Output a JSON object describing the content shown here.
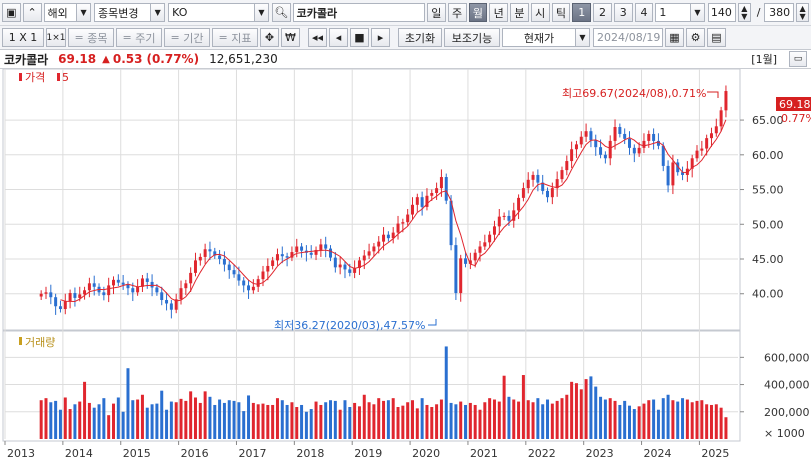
{
  "toolbar": {
    "market": "해외",
    "change_label": "종목변경",
    "symbol": "KO",
    "name": "코카콜라",
    "periods": [
      "일",
      "주",
      "월",
      "년",
      "분",
      "시",
      "틱"
    ],
    "active_period": "월",
    "counts": [
      "1",
      "2",
      "3",
      "4"
    ],
    "active_count": "1",
    "count_value": "1",
    "visible_bars": "140",
    "separator": "/",
    "total_bars": "380"
  },
  "toolbar2": {
    "layout_label": "1 X 1",
    "grid_label": "1×1",
    "stock_label": "종목",
    "cycle_label": "주기",
    "range_label": "기간",
    "indicator_label": "지표",
    "won_label": "₩",
    "reset_label": "초기화",
    "aux_label": "보조기능",
    "current_label": "현재가",
    "date_value": "2024/08/19"
  },
  "info": {
    "name": "코카콜라",
    "price": "69.18",
    "change_arrow": "▲",
    "change": "0.53",
    "change_pct": "(0.77%)",
    "volume": "12,651,230",
    "period_badge": "[1월]"
  },
  "chart_data": {
    "type": "candlestick",
    "legend_price": "가격",
    "legend_ma": "5",
    "legend_volume": "거래량",
    "price_axis": [
      "65.00",
      "60.00",
      "55.00",
      "50.00",
      "45.00",
      "40.00"
    ],
    "price_range": [
      35.5,
      71.2
    ],
    "volume_axis": [
      "600,000",
      "400,000",
      "200,000",
      "× 1000"
    ],
    "volume_range": [
      0,
      720000
    ],
    "current_price_label": "69.18",
    "current_pct_label": "0.77%",
    "max_annotation": "최고69.67(2024/08),0.71%",
    "min_annotation": "최저36.27(2020/03),47.57%",
    "years": [
      "2013",
      "2014",
      "2015",
      "2016",
      "2017",
      "2018",
      "2019",
      "2020",
      "2021",
      "2022",
      "2023",
      "2024",
      "2025"
    ],
    "first_month": "2013-01",
    "last_month": "2025-08",
    "colors": {
      "up": "#e0262e",
      "down": "#2a6fd0",
      "ma": "#e0262e",
      "grid": "#dddddd"
    },
    "closes": [
      40.0,
      40.2,
      39.5,
      38.2,
      37.8,
      38.9,
      40.1,
      39.4,
      39.9,
      40.5,
      41.5,
      41.0,
      40.2,
      39.8,
      41.2,
      42.0,
      41.6,
      41.3,
      40.8,
      40.2,
      41.0,
      42.2,
      41.7,
      40.9,
      40.2,
      39.1,
      38.6,
      37.7,
      39.2,
      40.8,
      41.5,
      43.0,
      44.8,
      45.3,
      46.4,
      46.1,
      45.5,
      45.0,
      44.2,
      43.4,
      42.8,
      41.9,
      41.2,
      40.5,
      41.0,
      42.1,
      43.2,
      44.0,
      44.8,
      45.7,
      45.4,
      45.2,
      46.0,
      46.8,
      46.2,
      45.9,
      45.6,
      46.3,
      47.1,
      46.5,
      45.2,
      43.8,
      44.2,
      43.5,
      43.0,
      43.7,
      44.8,
      45.5,
      46.1,
      46.8,
      47.5,
      48.5,
      48.0,
      48.8,
      50.1,
      50.3,
      51.4,
      52.8,
      53.9,
      52.5,
      54.1,
      54.5,
      55.2,
      56.8,
      53.4,
      47.0,
      40.1,
      45.1,
      44.3,
      44.8,
      45.9,
      46.8,
      47.4,
      48.5,
      49.7,
      51.1,
      51.2,
      50.5,
      52.0,
      53.8,
      55.2,
      56.4,
      57.1,
      56.0,
      54.8,
      53.9,
      55.2,
      56.5,
      57.8,
      59.1,
      60.8,
      61.5,
      62.6,
      63.4,
      62.1,
      61.1,
      60.0,
      59.5,
      62.0,
      64.0,
      63.0,
      62.3,
      61.0,
      60.2,
      61.0,
      62.0,
      63.0,
      62.0,
      61.3,
      58.4,
      55.6,
      58.9,
      57.5,
      57.1,
      58.0,
      59.5,
      60.6,
      60.9,
      62.4,
      63.1,
      64.1,
      66.4,
      69.18
    ],
    "volumes": [
      285000,
      300000,
      270000,
      280000,
      215000,
      305000,
      220000,
      255000,
      275000,
      420000,
      265000,
      230000,
      255000,
      300000,
      175000,
      260000,
      305000,
      200000,
      520000,
      285000,
      290000,
      325000,
      230000,
      255000,
      260000,
      355000,
      215000,
      275000,
      270000,
      295000,
      280000,
      350000,
      305000,
      265000,
      350000,
      310000,
      250000,
      290000,
      265000,
      285000,
      280000,
      270000,
      205000,
      320000,
      265000,
      255000,
      260000,
      250000,
      250000,
      300000,
      285000,
      250000,
      270000,
      235000,
      250000,
      200000,
      220000,
      275000,
      250000,
      270000,
      285000,
      280000,
      215000,
      285000,
      235000,
      265000,
      240000,
      325000,
      270000,
      255000,
      300000,
      280000,
      285000,
      300000,
      235000,
      245000,
      270000,
      285000,
      225000,
      300000,
      250000,
      235000,
      255000,
      290000,
      680000,
      265000,
      255000,
      275000,
      250000,
      265000,
      250000,
      215000,
      270000,
      300000,
      290000,
      275000,
      465000,
      310000,
      290000,
      275000,
      470000,
      285000,
      270000,
      300000,
      255000,
      290000,
      260000,
      280000,
      300000,
      325000,
      420000,
      410000,
      365000,
      440000,
      460000,
      385000,
      310000,
      290000,
      300000,
      280000,
      250000,
      280000,
      245000,
      220000,
      240000,
      260000,
      285000,
      290000,
      215000,
      300000,
      325000,
      285000,
      275000,
      300000,
      290000,
      270000,
      280000,
      285000,
      255000,
      250000,
      255000,
      230000,
      160000
    ]
  }
}
